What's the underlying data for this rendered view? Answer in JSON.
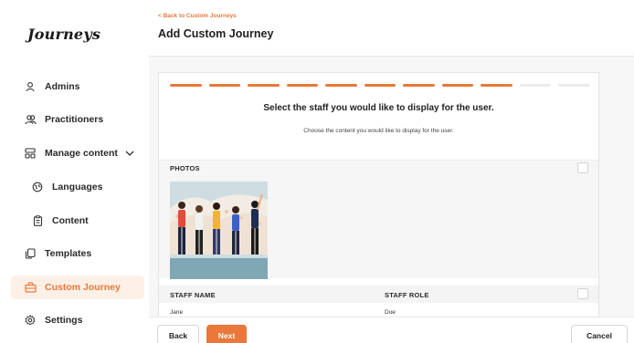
{
  "app": {
    "logo": "Journeys",
    "accent_color": "#e9783a"
  },
  "sidebar": {
    "items": [
      {
        "label": "Admins",
        "icon": "user-icon"
      },
      {
        "label": "Practitioners",
        "icon": "users-icon"
      },
      {
        "label": "Manage content",
        "icon": "layout-icon"
      },
      {
        "label": "Languages",
        "icon": "globe-icon"
      },
      {
        "label": "Content",
        "icon": "clipboard-icon"
      },
      {
        "label": "Templates",
        "icon": "copy-icon"
      },
      {
        "label": "Custom Journey",
        "icon": "briefcase-icon",
        "active": true
      },
      {
        "label": "Settings",
        "icon": "gear-icon"
      }
    ]
  },
  "header": {
    "back_link": "< Back to Custom Journeys",
    "title": "Add Custom Journey"
  },
  "wizard": {
    "steps_total": 11,
    "steps_done": 9,
    "title": "Select the staff you would like to display for the user.",
    "subtitle": "Choose the content you would like to display for the user."
  },
  "photos": {
    "label": "PHOTOS"
  },
  "staff": {
    "columns": [
      "STAFF NAME",
      "STAFF ROLE"
    ],
    "rows": [
      [
        "Jane",
        "Doe"
      ]
    ]
  },
  "footer": {
    "back_label": "Back",
    "next_label": "Next",
    "cancel_label": "Cancel"
  }
}
